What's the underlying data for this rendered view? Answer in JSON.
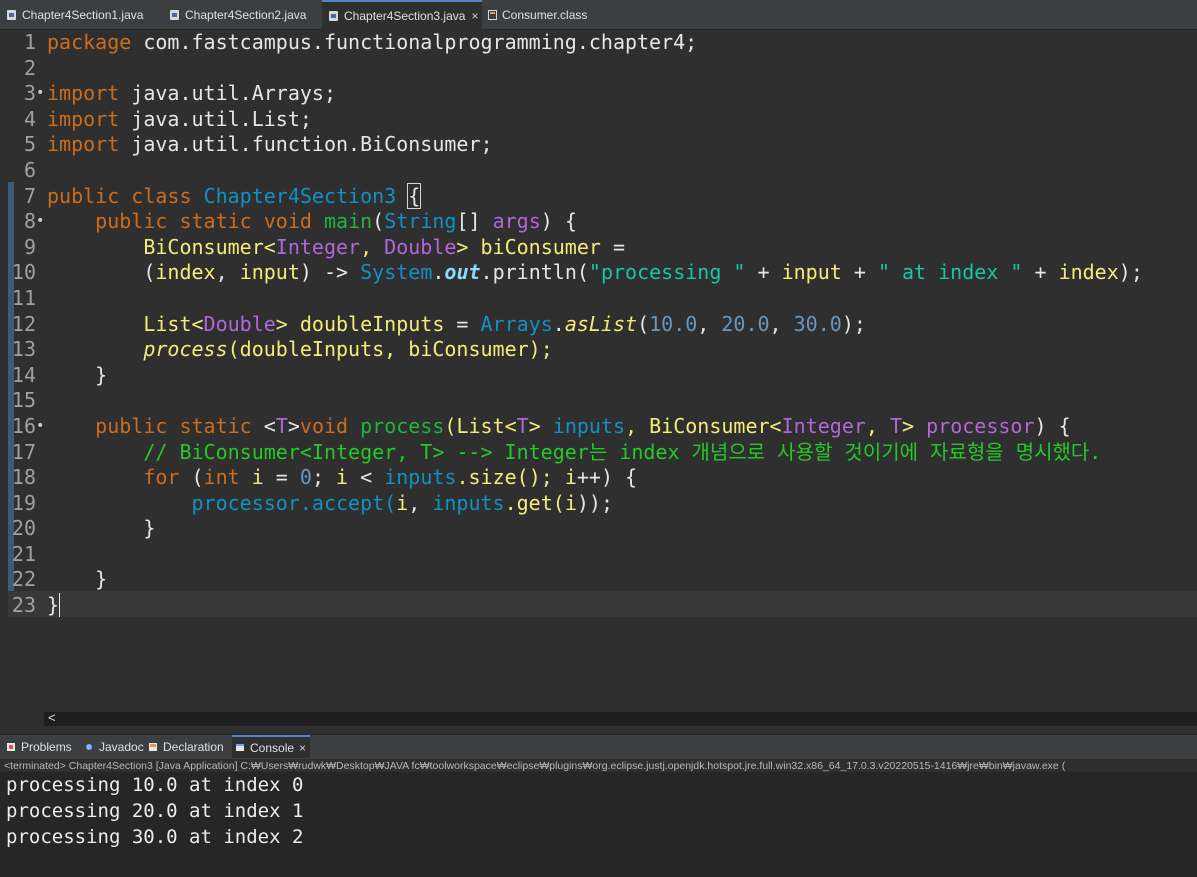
{
  "editor_tabs": [
    {
      "label": "Chapter4Section1.java",
      "active": false,
      "kind": "java"
    },
    {
      "label": "Chapter4Section2.java",
      "active": false,
      "kind": "java"
    },
    {
      "label": "Chapter4Section3.java",
      "active": true,
      "kind": "java",
      "close": "×"
    },
    {
      "label": "Consumer.class",
      "active": false,
      "kind": "class"
    }
  ],
  "code": {
    "l1": {
      "num": "1",
      "kw": "package",
      "rest": " com.fastcampus.functionalprogramming.chapter4;"
    },
    "l2": {
      "num": "2"
    },
    "l3": {
      "num": "3",
      "marker": "•",
      "kw": "import",
      "rest": " java.util.Arrays;"
    },
    "l4": {
      "num": "4",
      "kw": "import",
      "rest": " java.util.List;"
    },
    "l5": {
      "num": "5",
      "kw": "import",
      "rest": " java.util.function.BiConsumer;"
    },
    "l6": {
      "num": "6"
    },
    "l7": {
      "num": "7",
      "kw1": "public",
      "kw2": "class",
      "cls": "Chapter4Section3",
      "brace": "{"
    },
    "l8": {
      "num": "8",
      "marker": "•",
      "kw1": "public",
      "kw2": "static",
      "kw3": "void",
      "fn": "main",
      "p1": "(",
      "cls": "String",
      "p2": "[] ",
      "arg": "args",
      "p3": ") {"
    },
    "l9": {
      "num": "9",
      "t1": "BiConsumer<",
      "c1": "Integer",
      "t2": ", ",
      "c2": "Double",
      "t3": "> ",
      "v": "biConsumer",
      "t4": " ="
    },
    "l10": {
      "num": "10",
      "t1": "(",
      "a1": "index",
      "t2": ", ",
      "a2": "input",
      "t3": ") -> ",
      "c1": "System",
      "t4": ".",
      "out": "out",
      "t5": ".println(",
      "s1": "\"processing \"",
      "t6": " + ",
      "a3": "input",
      "t7": " + ",
      "s2": "\" at index \"",
      "t8": " + ",
      "a4": "index",
      "t9": ");"
    },
    "l11": {
      "num": "11"
    },
    "l12": {
      "num": "12",
      "t1": "List<",
      "c1": "Double",
      "t2": "> ",
      "v": "doubleInputs",
      "t3": " = ",
      "c2": "Arrays",
      "t4": ".",
      "m": "asList",
      "t5": "(",
      "n1": "10.0",
      "t6": ", ",
      "n2": "20.0",
      "t7": ", ",
      "n3": "30.0",
      "t8": ");"
    },
    "l13": {
      "num": "13",
      "m": "process",
      "t1": "(doubleInputs, biConsumer);"
    },
    "l14": {
      "num": "14",
      "t1": "}"
    },
    "l15": {
      "num": "15"
    },
    "l16": {
      "num": "16",
      "marker": "•",
      "kw1": "public",
      "kw2": "static",
      "t1": " <",
      "g1": "T",
      "t2": ">",
      "kw3": "void",
      "fn": "process",
      "t3": "(List<",
      "g2": "T",
      "t4": "> ",
      "a1": "inputs",
      "t5": ", BiConsumer<",
      "c1": "Integer",
      "t6": ", ",
      "g3": "T",
      "t7": "> ",
      "a2": "processor",
      "t8": ") {"
    },
    "l17": {
      "num": "17",
      "cmt": "// BiConsumer<Integer, T> --> Integer는 index 개념으로 사용할 것이기에 자료형을 명시했다."
    },
    "l18": {
      "num": "18",
      "kw1": "for",
      "t1": " (",
      "kw2": "int",
      "t2": " ",
      "v1": "i",
      "t3": " = ",
      "n1": "0",
      "t4": "; ",
      "v2": "i",
      "t5": " < ",
      "v3": "inputs",
      "t6": ".size(); ",
      "v4": "i",
      "t7": "++) {"
    },
    "l19": {
      "num": "19",
      "v1": "processor",
      "t1": ".accept(",
      "v2": "i",
      "t2": ", ",
      "v3": "inputs",
      "t3": ".get(",
      "v4": "i",
      "t4": "));"
    },
    "l20": {
      "num": "20",
      "t1": "}"
    },
    "l21": {
      "num": "21"
    },
    "l22": {
      "num": "22",
      "t1": "}"
    },
    "l23": {
      "num": "23",
      "t1": "}"
    }
  },
  "scrollbar": {
    "left_arrow": "<"
  },
  "view_tabs": [
    {
      "label": "Problems",
      "active": false,
      "icon": "problems-icon",
      "color": "#e05050"
    },
    {
      "label": "Javadoc",
      "active": false,
      "icon": "javadoc-icon",
      "color": "#7ab0ff"
    },
    {
      "label": "Declaration",
      "active": false,
      "icon": "declaration-icon",
      "color": "#e0a040"
    },
    {
      "label": "Console",
      "active": true,
      "icon": "console-icon",
      "color": "#6aa0ff",
      "close": "×"
    }
  ],
  "console": {
    "status": "<terminated> Chapter4Section3 [Java Application] C:₩Users₩rudwk₩Desktop₩JAVA fc₩toolworkspace₩eclipse₩plugins₩org.eclipse.justj.openjdk.hotspot.jre.full.win32.x86_64_17.0.3.v20220515-1416₩jre₩bin₩javaw.exe  (",
    "lines": [
      "processing 10.0 at index 0",
      "processing 20.0 at index 1",
      "processing 30.0 at index 2"
    ]
  }
}
